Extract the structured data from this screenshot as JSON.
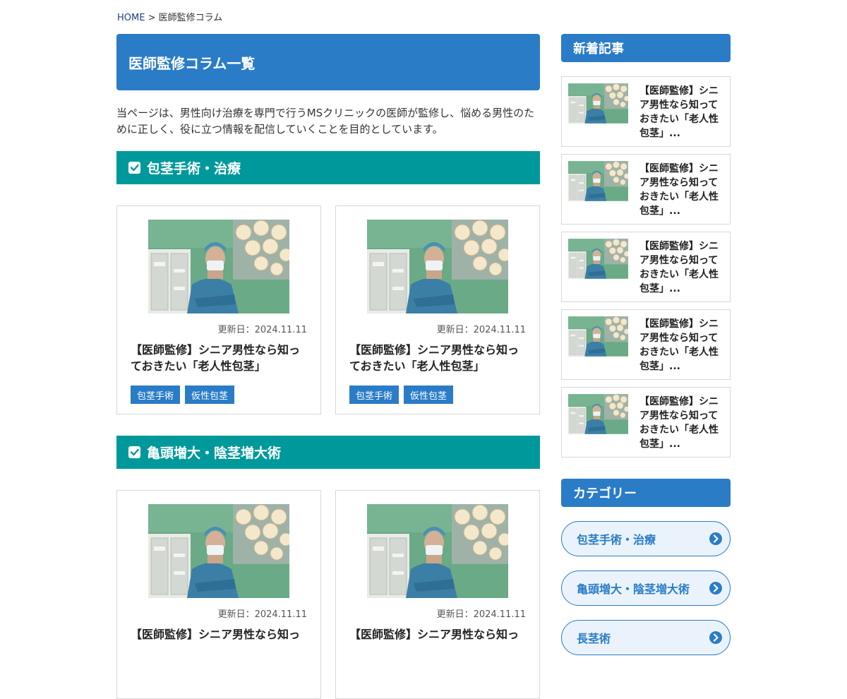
{
  "breadcrumb": {
    "home": "HOME",
    "separator": " > ",
    "current": "医師監修コラム"
  },
  "page": {
    "title": "医師監修コラム一覧",
    "intro": "当ページは、男性向け治療を専門で行うMSクリニックの医師が監修し、悩める男性のために正しく、役に立つ情報を配信していくことを目的としています。"
  },
  "sections": [
    {
      "title": "包茎手術・治療",
      "cards": [
        {
          "date": "更新日：2024.11.11",
          "title": "【医師監修】シニア男性なら知っておきたい「老人性包茎」",
          "tags": [
            "包茎手術",
            "仮性包茎"
          ]
        },
        {
          "date": "更新日：2024.11.11",
          "title": "【医師監修】シニア男性なら知っておきたい「老人性包茎」",
          "tags": [
            "包茎手術",
            "仮性包茎"
          ]
        }
      ]
    },
    {
      "title": "亀頭増大・陰茎増大術",
      "cards": [
        {
          "date": "更新日：2024.11.11",
          "title": "【医師監修】シニア男性なら知っ"
        },
        {
          "date": "更新日：2024.11.11",
          "title": "【医師監修】シニア男性なら知っ"
        }
      ]
    }
  ],
  "sidebar": {
    "news_title": "新着記事",
    "news": [
      {
        "title": "【医師監修】シニア男性なら知っておきたい「老人性包茎」..."
      },
      {
        "title": "【医師監修】シニア男性なら知っておきたい「老人性包茎」..."
      },
      {
        "title": "【医師監修】シニア男性なら知っておきたい「老人性包茎」..."
      },
      {
        "title": "【医師監修】シニア男性なら知っておきたい「老人性包茎」..."
      },
      {
        "title": "【医師監修】シニア男性なら知っておきたい「老人性包茎」..."
      }
    ],
    "category_title": "カテゴリー",
    "categories": [
      "包茎手術・治療",
      "亀頭増大・陰茎増大術",
      "長茎術"
    ]
  },
  "icons": {
    "checkbox": "check-square-icon",
    "arrow": "chevron-circle-right-icon",
    "photo": "surgeon-photo"
  },
  "colors": {
    "primary": "#2a7cc7",
    "teal": "#00999b",
    "border": "#d8d8d8"
  }
}
